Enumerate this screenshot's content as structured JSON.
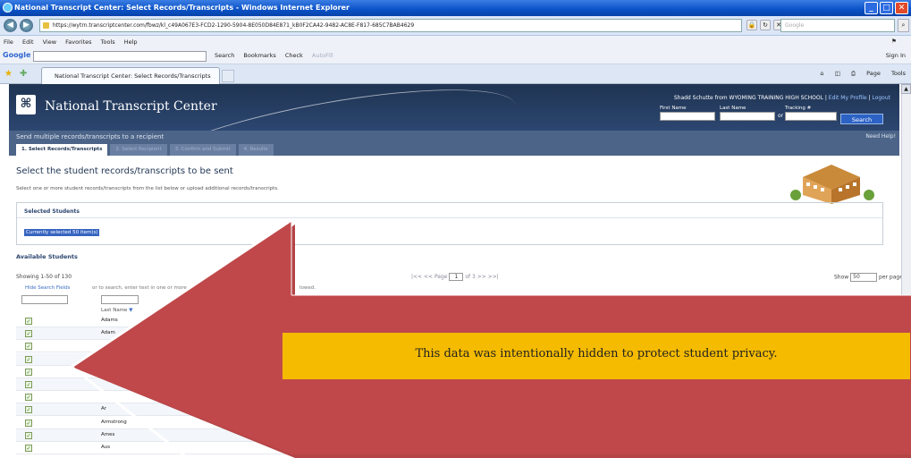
{
  "window": {
    "title": "National Transcript Center: Select Records/Transcripts - Windows Internet Explorer"
  },
  "address": {
    "url": "https://wytrn.transcriptcenter.com/fbwz/kl_c49A067E3-FCD2-1290-5904-8E050D84E871_kB0F2CA42-9482-AC8E-F817-685C7BAB4629",
    "search_placeholder": "Google"
  },
  "menu": {
    "items": [
      "File",
      "Edit",
      "View",
      "Favorites",
      "Tools",
      "Help"
    ]
  },
  "google_toolbar": {
    "logo": "Google",
    "tools": [
      "Search",
      "Bookmarks",
      "Check",
      "AutoFill"
    ],
    "signin": "Sign In"
  },
  "tab": {
    "title": "National Transcript Center: Select Records/Transcripts"
  },
  "commandbar": {
    "items": [
      "Page",
      "Tools"
    ]
  },
  "site": {
    "logo_glyph": "⌘",
    "title": "National Transcript Center",
    "user_name": "Shadd Schutte from WYOMING TRAINING HIGH SCHOOL",
    "edit_profile": "Edit My Profile",
    "logout": "Logout",
    "first_name_label": "First Name",
    "last_name_label": "Last Name",
    "tracking_label": "Tracking #",
    "or": "or",
    "search_button": "Search"
  },
  "wizard": {
    "caption": "Send multiple records/transcripts to a recipient",
    "need_help": "Need Help!",
    "steps": [
      "1. Select Records/Transcripts",
      "2. Select Recipient",
      "3. Confirm and Submit",
      "4. Results"
    ]
  },
  "page": {
    "heading": "Select the student records/transcripts to be sent",
    "instructions": "Select one or more student records/transcripts from the list below or upload additional records/transcripts.",
    "selected_title": "Selected Students",
    "selected_summary": "Currently selected 50 item(s)",
    "available_title": "Available Students",
    "showing": "Showing 1-50 of 130",
    "pager_prev": "|<< << Page",
    "pager_page": "1",
    "pager_next": "of 3 >> >>|",
    "show_label": "Show",
    "per_page_value": "50",
    "per_page_label": "per page",
    "hide_search_fields": "Hide Search Fields",
    "filter_hint": "or to search, enter text in one or more",
    "filter_hint2": "lowed.",
    "last_name_col": "Last Name"
  },
  "rows": [
    {
      "name": "Adams"
    },
    {
      "name": "Adam"
    },
    {
      "name": ""
    },
    {
      "name": ""
    },
    {
      "name": ""
    },
    {
      "name": ""
    },
    {
      "name": ""
    },
    {
      "name": "Ar"
    },
    {
      "name": "Armstrong"
    },
    {
      "name": "Ames"
    },
    {
      "name": "Aus"
    }
  ],
  "privacy_notice": "This data was intentionally hidden to protect student privacy.",
  "colors": {
    "arrow_red": "#c0484a",
    "banner_yellow": "#f5bb00",
    "header_navy": "#1f3452"
  }
}
